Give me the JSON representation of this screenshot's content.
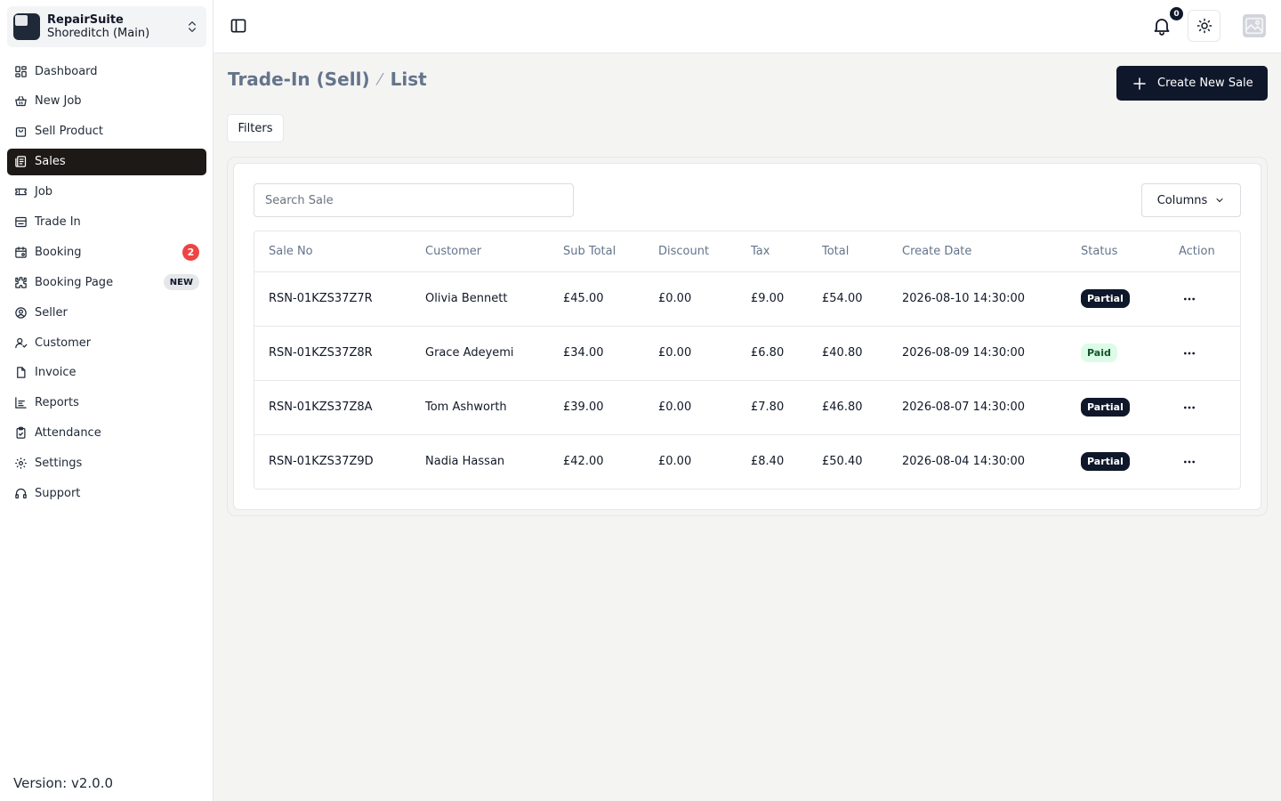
{
  "store": {
    "name": "RepairSuite",
    "branch": "Shoreditch (Main)"
  },
  "nav": [
    {
      "label": "Dashboard",
      "icon": "dashboard-icon"
    },
    {
      "label": "New Job",
      "icon": "new-job-icon"
    },
    {
      "label": "Sell Product",
      "icon": "shopping-bag-icon"
    },
    {
      "label": "Sales",
      "icon": "sales-icon",
      "active": true
    },
    {
      "label": "Job",
      "icon": "ticket-icon"
    },
    {
      "label": "Trade In",
      "icon": "trade-in-icon"
    },
    {
      "label": "Booking",
      "icon": "calendar-icon",
      "badge": "2"
    },
    {
      "label": "Booking Page",
      "icon": "puzzle-icon",
      "tag": "NEW"
    },
    {
      "label": "Seller",
      "icon": "at-sign-icon"
    },
    {
      "label": "Customer",
      "icon": "user-icon"
    },
    {
      "label": "Invoice",
      "icon": "file-icon"
    },
    {
      "label": "Reports",
      "icon": "reports-icon"
    },
    {
      "label": "Attendance",
      "icon": "clipboard-check-icon"
    },
    {
      "label": "Settings",
      "icon": "gear-icon"
    },
    {
      "label": "Support",
      "icon": "headphones-icon"
    }
  ],
  "version": "Version: v2.0.0",
  "header": {
    "notification_count": "0"
  },
  "breadcrumb": {
    "section": "Trade-In (Sell)",
    "separator": "⁄",
    "page": "List"
  },
  "create_button": "Create New Sale",
  "filters_button": "Filters",
  "search": {
    "placeholder": "Search Sale",
    "value": ""
  },
  "columns_button": "Columns",
  "table": {
    "headers": [
      "Sale No",
      "Customer",
      "Sub Total",
      "Discount",
      "Tax",
      "Total",
      "Create Date",
      "Status",
      "Action"
    ],
    "rows": [
      {
        "sale_no": "RSN-01KZS37Z7R",
        "customer": "Olivia Bennett",
        "sub_total": "£45.00",
        "discount": "£0.00",
        "tax": "£9.00",
        "total": "£54.00",
        "date": "2026-08-10 14:30:00",
        "status": "Partial"
      },
      {
        "sale_no": "RSN-01KZS37Z8R",
        "customer": "Grace Adeyemi",
        "sub_total": "£34.00",
        "discount": "£0.00",
        "tax": "£6.80",
        "total": "£40.80",
        "date": "2026-08-09 14:30:00",
        "status": "Paid"
      },
      {
        "sale_no": "RSN-01KZS37Z8A",
        "customer": "Tom Ashworth",
        "sub_total": "£39.00",
        "discount": "£0.00",
        "tax": "£7.80",
        "total": "£46.80",
        "date": "2026-08-07 14:30:00",
        "status": "Partial"
      },
      {
        "sale_no": "RSN-01KZS37Z9D",
        "customer": "Nadia Hassan",
        "sub_total": "£42.00",
        "discount": "£0.00",
        "tax": "£8.40",
        "total": "£50.40",
        "date": "2026-08-04 14:30:00",
        "status": "Partial"
      }
    ]
  },
  "colors": {
    "primary": "#0f172a",
    "active_nav": "#1c1917",
    "badge_red": "#ef4444",
    "paid_bg": "#dcfce7"
  }
}
